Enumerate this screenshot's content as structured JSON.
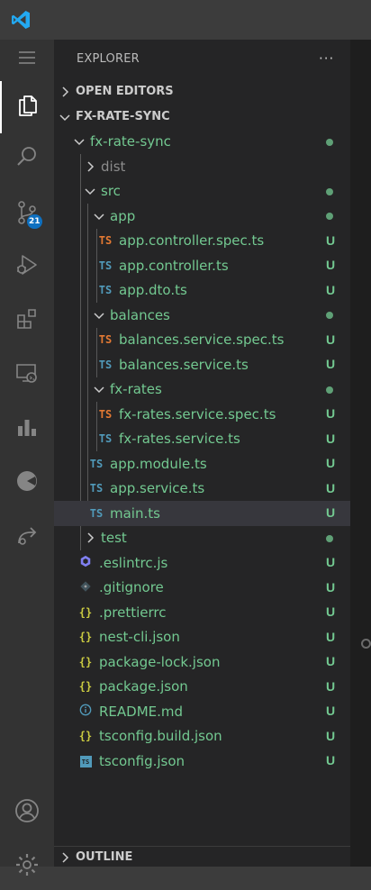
{
  "sidebar": {
    "title": "EXPLORER",
    "more_label": "···",
    "open_editors": "OPEN EDITORS",
    "outline": "OUTLINE"
  },
  "activity": {
    "scm_badge": "21"
  },
  "tree": {
    "root": "FX-RATE-SYNC",
    "items": [
      {
        "label": "fx-rate-sync",
        "kind": "folder",
        "status": "dot"
      },
      {
        "label": "dist",
        "kind": "folder",
        "status": ""
      },
      {
        "label": "src",
        "kind": "folder",
        "status": "dot"
      },
      {
        "label": "app",
        "kind": "folder",
        "status": "dot"
      },
      {
        "label": "app.controller.spec.ts",
        "kind": "ts-spec",
        "icon": "TS",
        "status": "U"
      },
      {
        "label": "app.controller.ts",
        "kind": "ts",
        "icon": "TS",
        "status": "U"
      },
      {
        "label": "app.dto.ts",
        "kind": "ts",
        "icon": "TS",
        "status": "U"
      },
      {
        "label": "balances",
        "kind": "folder",
        "status": "dot"
      },
      {
        "label": "balances.service.spec.ts",
        "kind": "ts-spec",
        "icon": "TS",
        "status": "U"
      },
      {
        "label": "balances.service.ts",
        "kind": "ts",
        "icon": "TS",
        "status": "U"
      },
      {
        "label": "fx-rates",
        "kind": "folder",
        "status": "dot"
      },
      {
        "label": "fx-rates.service.spec.ts",
        "kind": "ts-spec",
        "icon": "TS",
        "status": "U"
      },
      {
        "label": "fx-rates.service.ts",
        "kind": "ts",
        "icon": "TS",
        "status": "U"
      },
      {
        "label": "app.module.ts",
        "kind": "ts",
        "icon": "TS",
        "status": "U"
      },
      {
        "label": "app.service.ts",
        "kind": "ts",
        "icon": "TS",
        "status": "U"
      },
      {
        "label": "main.ts",
        "kind": "ts",
        "icon": "TS",
        "status": "U"
      },
      {
        "label": "test",
        "kind": "folder",
        "status": "dot"
      },
      {
        "label": ".eslintrc.js",
        "kind": "eslint",
        "status": "U"
      },
      {
        "label": ".gitignore",
        "kind": "git",
        "status": "U"
      },
      {
        "label": ".prettierrc",
        "kind": "json",
        "icon": "{}",
        "status": "U"
      },
      {
        "label": "nest-cli.json",
        "kind": "json",
        "icon": "{}",
        "status": "U"
      },
      {
        "label": "package-lock.json",
        "kind": "json",
        "icon": "{}",
        "status": "U"
      },
      {
        "label": "package.json",
        "kind": "json",
        "icon": "{}",
        "status": "U"
      },
      {
        "label": "README.md",
        "kind": "info",
        "status": "U"
      },
      {
        "label": "tsconfig.build.json",
        "kind": "json",
        "icon": "{}",
        "status": "U"
      },
      {
        "label": "tsconfig.json",
        "kind": "tsconfig",
        "icon": "TS",
        "status": "U"
      }
    ]
  },
  "colors": {
    "untracked": "#73c991",
    "ts_icon": "#519aba",
    "spec_icon": "#e37933",
    "json_icon": "#cbcb41"
  }
}
